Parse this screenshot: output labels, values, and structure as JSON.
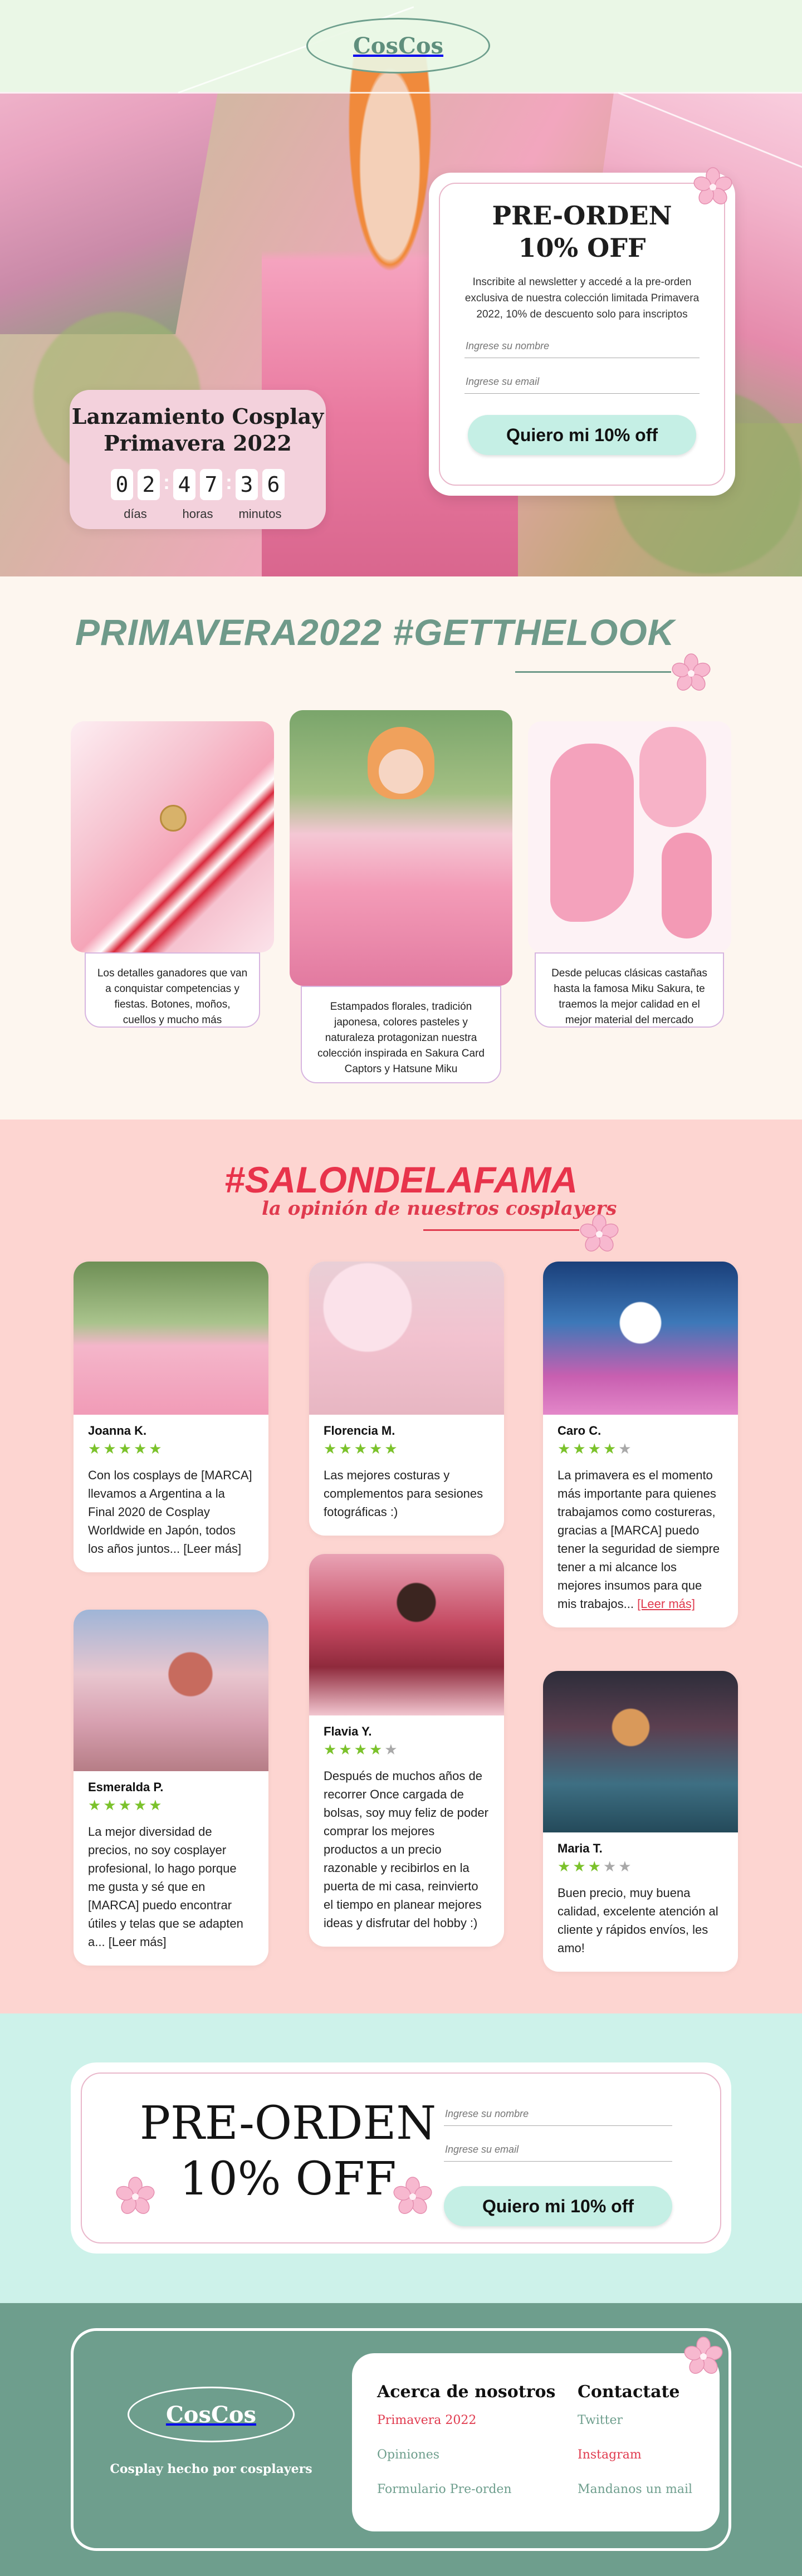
{
  "brand": {
    "logo": "CosCos",
    "accent_green": "#6e9e8d",
    "accent_pink": "#e9b8cb",
    "accent_red": "#e03a4e",
    "mint": "#c5efe5"
  },
  "hero": {
    "countdown": {
      "title": "Lanzamiento Cosplay Primavera 2022",
      "days_digits": [
        "0",
        "2"
      ],
      "hours_digits": [
        "4",
        "7"
      ],
      "minutes_digits": [
        "3",
        "6"
      ],
      "days_label": "días",
      "hours_label": "horas",
      "minutes_label": "minutos"
    },
    "preorder": {
      "title_line1": "PRE-ORDEN",
      "title_line2": "10% OFF",
      "description": "Inscribite al newsletter y accedé a la pre-orden exclusiva de nuestra colección limitada Primavera 2022, 10% de descuento solo para inscriptos",
      "name_placeholder": "Ingrese su nombre",
      "email_placeholder": "Ingrese su email",
      "cta": "Quiero mi 10% off"
    }
  },
  "look": {
    "title": "PRIMAVERA2022 #GETTHELOOK",
    "items": [
      {
        "caption": "Los detalles ganadores que van a conquistar competencias y fiestas. Botones, moños, cuellos y mucho más"
      },
      {
        "caption": "Estampados florales, tradición japonesa, colores pasteles y naturaleza protagonizan nuestra colección inspirada en Sakura Card Captors y Hatsune Miku"
      },
      {
        "caption": "Desde pelucas clásicas castañas hasta la famosa Miku Sakura, te traemos la mejor calidad en el mejor material del mercado"
      }
    ]
  },
  "salon": {
    "title": "#SALONDELAFAMA",
    "subtitle": "la opinión de nuestros cosplayers",
    "reviews": [
      {
        "name": "Joanna K.",
        "rating": 5,
        "text": "Con los cosplays de [MARCA] llevamos a Argentina a la Final 2020 de Cosplay Worldwide en Japón, todos los años juntos...",
        "more": "[Leer más]"
      },
      {
        "name": "Florencia M.",
        "rating": 5,
        "text": "Las mejores costuras y complementos para sesiones fotográficas :)",
        "more": ""
      },
      {
        "name": "Caro C.",
        "rating": 4,
        "text": "La primavera es el momento más importante para quienes trabajamos como costureras, gracias a [MARCA] puedo tener la seguridad de siempre tener a mi alcance los mejores insumos para que mis trabajos...",
        "more": "[Leer más]"
      },
      {
        "name": "Esmeralda P.",
        "rating": 5,
        "text": "La mejor diversidad de precios, no soy cosplayer profesional, lo hago porque me gusta y sé que en [MARCA] puedo encontrar útiles y telas que se adapten a...",
        "more": "[Leer más]"
      },
      {
        "name": "Flavia Y.",
        "rating": 4,
        "text": "Después de muchos años de recorrer Once cargada de bolsas, soy muy feliz de poder comprar los mejores productos a un precio razonable y recibirlos en la puerta de mi casa, reinvierto el tiempo en planear mejores ideas y disfrutar del hobby :)",
        "more": ""
      },
      {
        "name": "Maria T.",
        "rating": 3,
        "text": "Buen precio, muy buena calidad, excelente atención al cliente y rápidos envíos, les amo!",
        "more": ""
      }
    ]
  },
  "banner": {
    "title_line1": "PRE-ORDEN",
    "title_line2": "10% OFF",
    "name_placeholder": "Ingrese su nombre",
    "email_placeholder": "Ingrese su email",
    "cta": "Quiero mi 10% off"
  },
  "footer": {
    "logo": "CosCos",
    "tagline": "Cosplay hecho por cosplayers",
    "about": {
      "title": "Acerca de nosotros",
      "links": [
        "Primavera 2022",
        "Opiniones",
        "Formulario Pre-orden"
      ]
    },
    "contact": {
      "title": "Contactate",
      "links": [
        "Twitter",
        "Instagram",
        "Mandanos un mail"
      ]
    }
  }
}
